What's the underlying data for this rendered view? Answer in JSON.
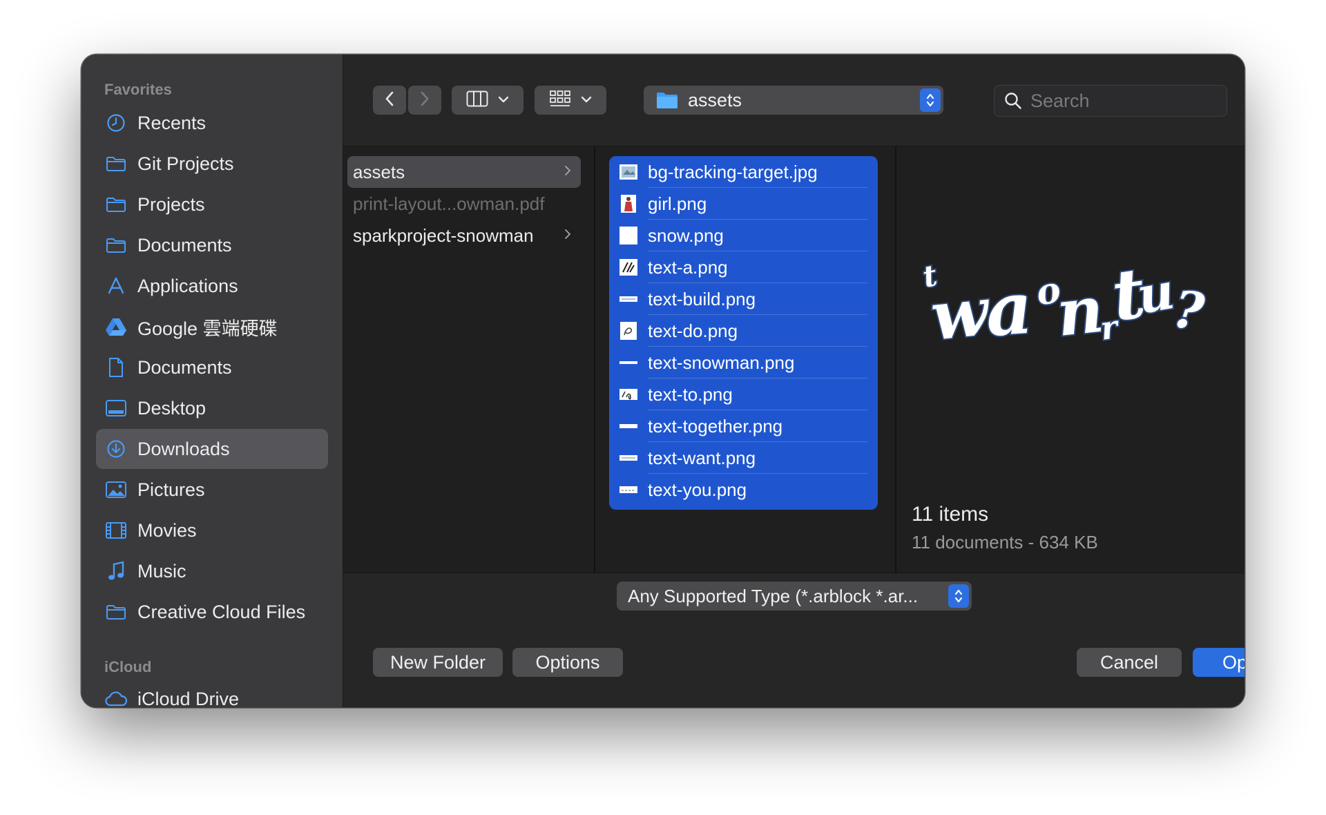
{
  "sidebar": {
    "favorites_title": "Favorites",
    "items": [
      {
        "label": "Recents",
        "icon": "clock-icon"
      },
      {
        "label": "Git Projects",
        "icon": "folder-icon"
      },
      {
        "label": "Projects",
        "icon": "folder-icon"
      },
      {
        "label": "Documents",
        "icon": "folder-icon"
      },
      {
        "label": "Applications",
        "icon": "applications-icon"
      },
      {
        "label": "Google 雲端硬碟",
        "icon": "google-drive-icon"
      },
      {
        "label": "Documents",
        "icon": "document-icon"
      },
      {
        "label": "Desktop",
        "icon": "desktop-icon"
      },
      {
        "label": "Downloads",
        "icon": "download-icon",
        "selected": true
      },
      {
        "label": "Pictures",
        "icon": "photo-icon"
      },
      {
        "label": "Movies",
        "icon": "film-icon"
      },
      {
        "label": "Music",
        "icon": "music-note-icon"
      },
      {
        "label": "Creative Cloud Files",
        "icon": "folder-icon"
      }
    ],
    "icloud_title": "iCloud",
    "icloud_items": [
      {
        "label": "iCloud Drive",
        "icon": "cloud-icon"
      }
    ]
  },
  "toolbar": {
    "path_label": "assets",
    "search_placeholder": "Search"
  },
  "column1": {
    "items": [
      {
        "label": "assets",
        "selected": true,
        "has_children": true
      },
      {
        "label": "print-layout...owman.pdf",
        "dimmed": true
      },
      {
        "label": "sparkproject-snowman",
        "has_children": true
      }
    ]
  },
  "column2": {
    "files": [
      {
        "label": "bg-tracking-target.jpg"
      },
      {
        "label": "girl.png"
      },
      {
        "label": "snow.png"
      },
      {
        "label": "text-a.png"
      },
      {
        "label": "text-build.png"
      },
      {
        "label": "text-do.png"
      },
      {
        "label": "text-snowman.png"
      },
      {
        "label": "text-to.png"
      },
      {
        "label": "text-together.png"
      },
      {
        "label": "text-want.png"
      },
      {
        "label": "text-you.png"
      }
    ]
  },
  "preview": {
    "count": "11 items",
    "detail": "11 documents - 634 KB"
  },
  "format": {
    "label": "Any Supported Type (*.arblock *.ar..."
  },
  "buttons": {
    "new_folder": "New Folder",
    "options": "Options",
    "cancel": "Cancel",
    "open": "Open"
  },
  "colors": {
    "accent": "#2a6ee0",
    "selection": "#1f56d0",
    "sidebar_icon": "#4a9af5"
  }
}
